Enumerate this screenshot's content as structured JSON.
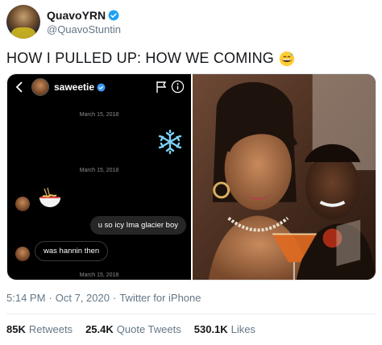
{
  "author": {
    "display_name": "QuavoYRN",
    "handle": "@QuavoStuntin",
    "verified": true
  },
  "tweet": {
    "text": "HOW I PULLED UP:  HOW WE COMING",
    "emoji": "grinning-sweat-face-emoji"
  },
  "dm_screenshot": {
    "username": "saweetie",
    "verified": true,
    "dates": [
      "March 15, 2018",
      "March 15, 2018",
      "March 15, 2018"
    ],
    "messages": [
      {
        "direction": "in",
        "type": "emoji",
        "emoji": "snowflake-icon"
      },
      {
        "direction": "in",
        "type": "emoji",
        "emoji": "noodle-bowl-icon"
      },
      {
        "direction": "out",
        "type": "text",
        "text": "u so icy Ima glacier boy"
      },
      {
        "direction": "in",
        "type": "text",
        "text": "was hannin then"
      }
    ]
  },
  "meta": {
    "time": "5:14 PM",
    "date": "Oct 7, 2020",
    "separator": "·",
    "source": "Twitter for iPhone"
  },
  "stats": {
    "retweets_count": "85K",
    "retweets_label": "Retweets",
    "quote_count": "25.4K",
    "quote_label": "Quote Tweets",
    "likes_count": "530.1K",
    "likes_label": "Likes"
  },
  "colors": {
    "verified_blue": "#1da1f2",
    "secondary_text": "#657786",
    "primary_text": "#14171a"
  }
}
